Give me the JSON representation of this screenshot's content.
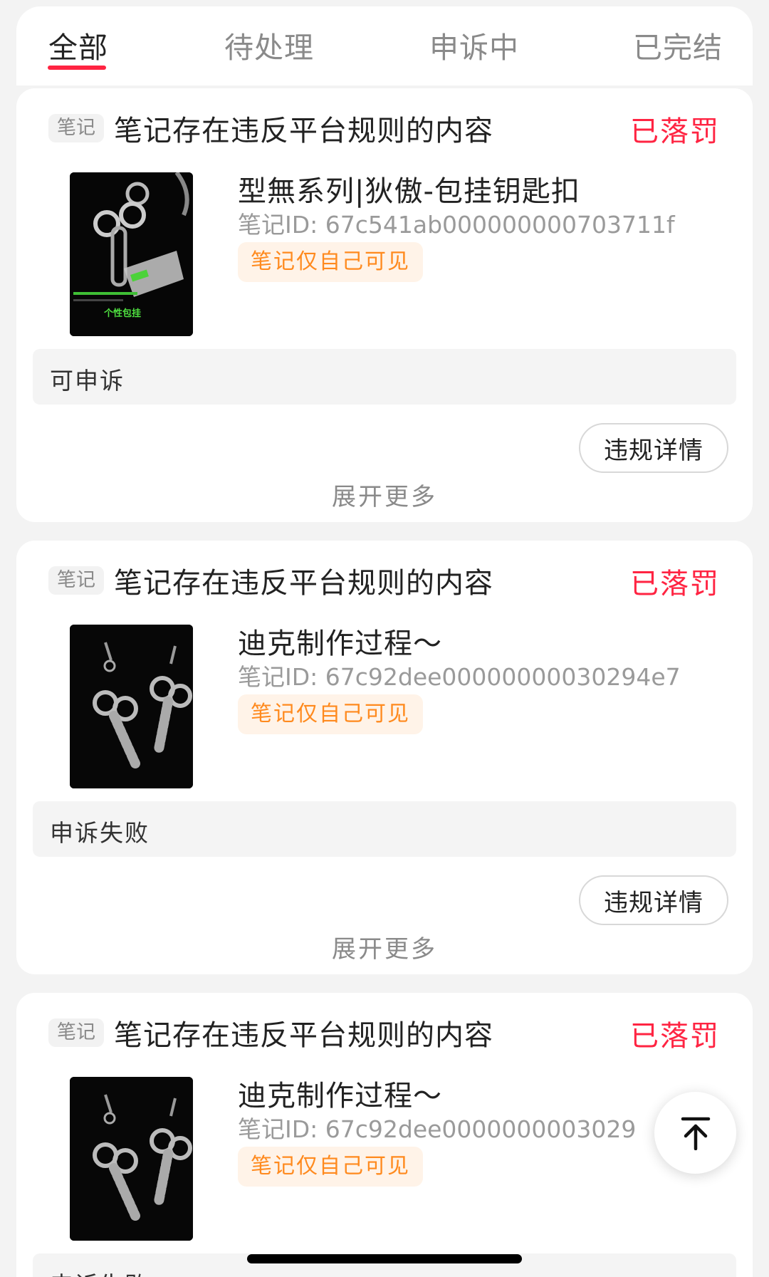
{
  "tabs": [
    {
      "label": "全部",
      "active": true
    },
    {
      "label": "待处理",
      "active": false
    },
    {
      "label": "申诉中",
      "active": false
    },
    {
      "label": "已完结",
      "active": false
    }
  ],
  "cards": [
    {
      "type_tag": "笔记",
      "title": "笔记存在违反平台规则的内容",
      "status": "已落罚",
      "note_name": "型無系列|狄傲-包挂钥匙扣",
      "note_id": "笔记ID: 67c541ab000000000703711f",
      "visibility": "笔记仅自己可见",
      "appeal_status": "可申诉",
      "thumb_caption": "个性包挂",
      "detail_button": "违规详情",
      "expand_label": "展开更多"
    },
    {
      "type_tag": "笔记",
      "title": "笔记存在违反平台规则的内容",
      "status": "已落罚",
      "note_name": "迪克制作过程～",
      "note_id": "笔记ID: 67c92dee00000000030294e7",
      "visibility": "笔记仅自己可见",
      "appeal_status": "申诉失败",
      "detail_button": "违规详情",
      "expand_label": "展开更多"
    },
    {
      "type_tag": "笔记",
      "title": "笔记存在违反平台规则的内容",
      "status": "已落罚",
      "note_name": "迪克制作过程～",
      "note_id": "笔记ID: 67c92dee0000000003029",
      "visibility": "笔记仅自己可见",
      "appeal_status": "申诉失败"
    }
  ],
  "icons": {
    "scroll_top": "arrow-up-to-top-icon"
  },
  "colors": {
    "accent": "#ff2442",
    "badge_text": "#ff8a1e",
    "badge_bg": "#fff3e8"
  }
}
